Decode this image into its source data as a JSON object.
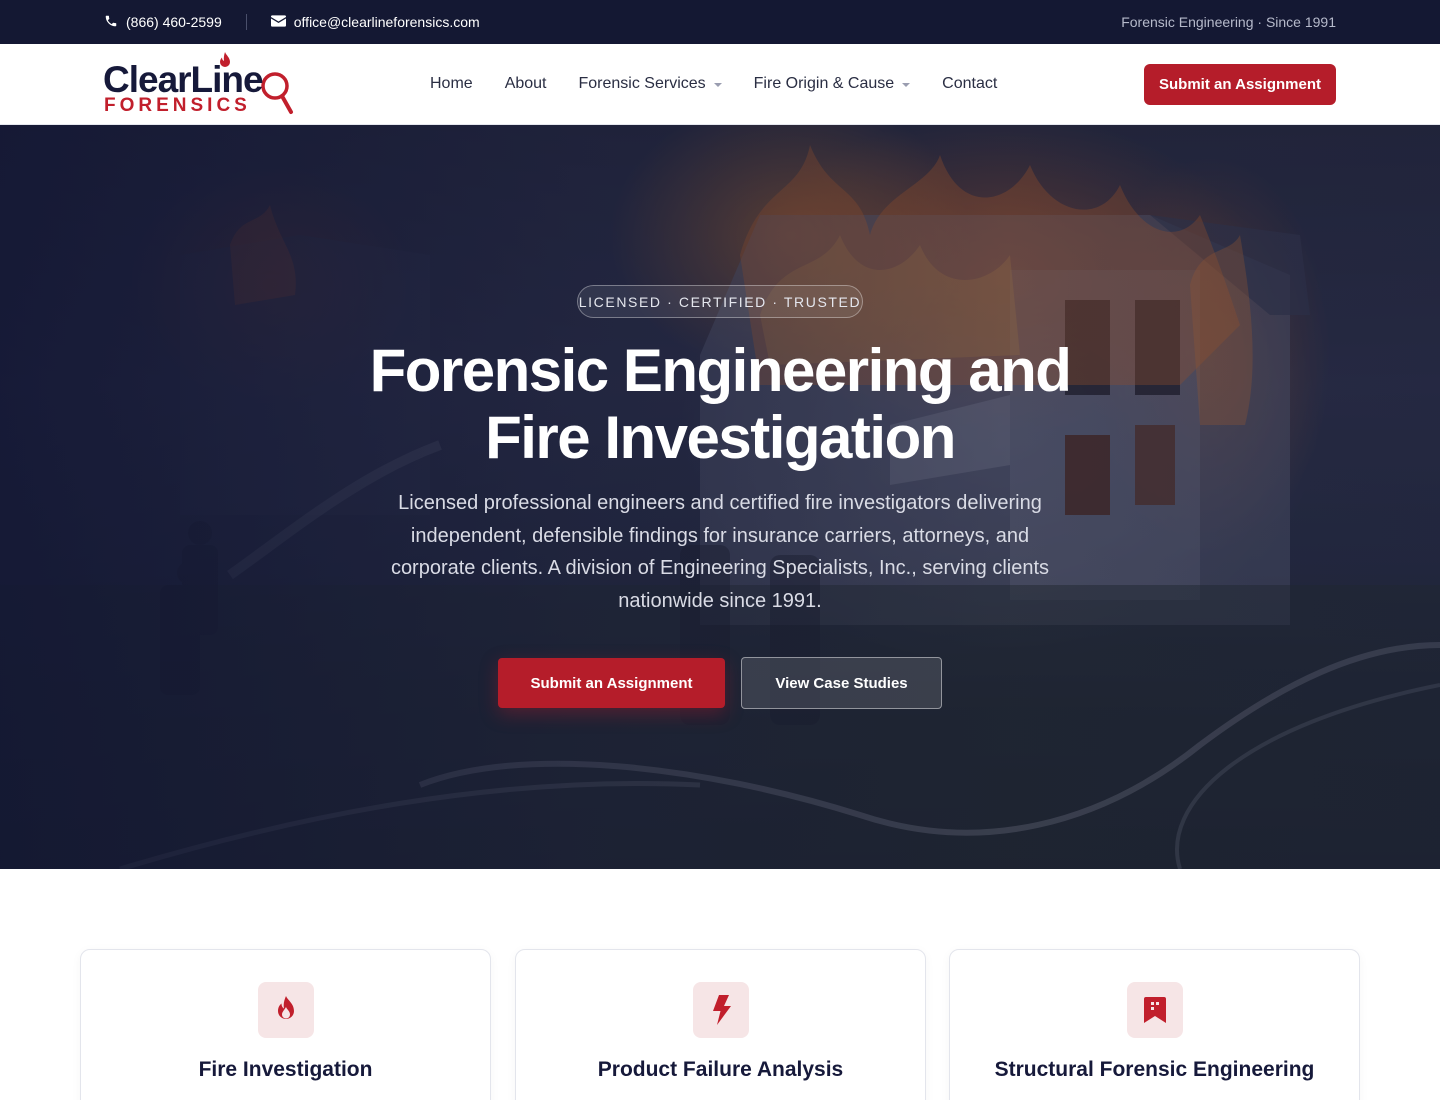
{
  "topbar": {
    "phone": "(866) 460-2599",
    "email": "office@clearlineforensics.com",
    "tagline": "Forensic Engineering · Since 1991",
    "phone_icon": "phone-icon",
    "email_icon": "envelope-icon"
  },
  "brand": {
    "name_top": "ClearLine",
    "name_bottom": "FORENSICS",
    "color_navy": "#16193a",
    "color_red": "#c11f2c"
  },
  "nav": {
    "items": [
      {
        "label": "Home",
        "has_dropdown": false
      },
      {
        "label": "About",
        "has_dropdown": false
      },
      {
        "label": "Forensic Services",
        "has_dropdown": true
      },
      {
        "label": "Fire Origin & Cause",
        "has_dropdown": true
      },
      {
        "label": "Contact",
        "has_dropdown": false
      }
    ],
    "cta_label": "Submit an Assignment"
  },
  "hero": {
    "badge": "LICENSED · CERTIFIED · TRUSTED",
    "title_line1": "Forensic Engineering and",
    "title_line2": "Fire Investigation",
    "subtitle": "Licensed professional engineers and certified fire investigators delivering independent, defensible findings for insurance carriers, attorneys, and corporate clients. A division of Engineering Specialists, Inc., serving clients nationwide since 1991.",
    "primary_button": "Submit an Assignment",
    "secondary_button": "View Case Studies"
  },
  "services": [
    {
      "title": "Fire Investigation",
      "icon": "flame-icon"
    },
    {
      "title": "Product Failure Analysis",
      "icon": "lightning-bolt-icon"
    },
    {
      "title": "Structural Forensic Engineering",
      "icon": "bookmark-building-icon"
    }
  ],
  "colors": {
    "accent": "#b51d2a",
    "topbar_bg": "#141833",
    "icon_tile_bg": "#f6e5e6"
  }
}
